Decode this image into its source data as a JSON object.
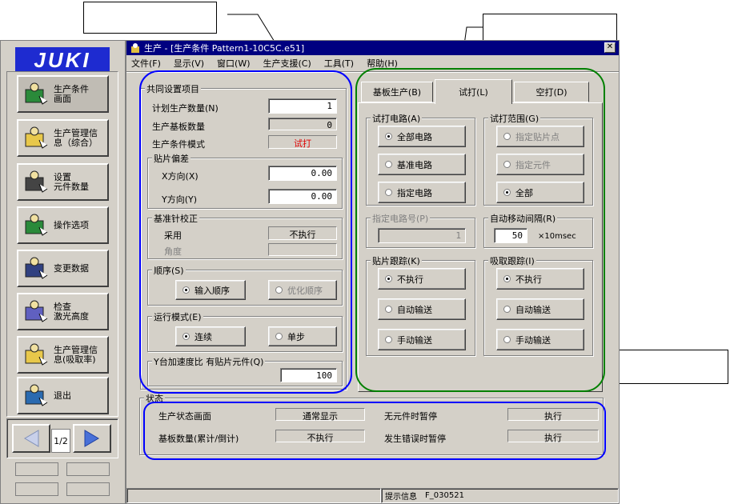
{
  "sidebar": {
    "logo": "JUKI",
    "items": [
      {
        "label": "生产条件\n画面",
        "icon": "production-condition-icon"
      },
      {
        "label": "生产管理信\n息（综合）",
        "icon": "production-info-icon"
      },
      {
        "label": "设置\n元件数量",
        "icon": "component-count-icon"
      },
      {
        "label": "操作选项",
        "icon": "operation-option-icon"
      },
      {
        "label": "变更数据",
        "icon": "edit-data-icon"
      },
      {
        "label": "检查\n激光高度",
        "icon": "laser-height-icon"
      },
      {
        "label": "生产管理信\n息(吸取率)",
        "icon": "pickup-rate-icon"
      },
      {
        "label": "退出",
        "icon": "exit-door-icon"
      }
    ],
    "page_indicator": "1/2"
  },
  "window": {
    "title": "生产 - [生产条件 Pattern1-10C5C.e51]",
    "menu": [
      "文件(F)",
      "显示(V)",
      "窗口(W)",
      "生产支援(C)",
      "工具(T)",
      "帮助(H)"
    ]
  },
  "common": {
    "group_title": "共同设置项目",
    "planned_qty_label": "计划生产数量(N)",
    "planned_qty": "1",
    "produced_qty_label": "生产基板数量",
    "produced_qty": "0",
    "mode_label": "生产条件模式",
    "mode_value": "试打",
    "offset_group": "贴片偏差",
    "x_label": "X方向(X)",
    "x_value": "0.00",
    "y_label": "Y方向(Y)",
    "y_value": "0.00",
    "ref_group": "基准针校正",
    "adopt_label": "采用",
    "adopt_value": "不执行",
    "angle_label": "角度",
    "angle_value": "",
    "order_group": "顺序(S)",
    "order_input": "输入顺序",
    "order_opt": "优化顺序",
    "run_group": "运行模式(E)",
    "run_cont": "连续",
    "run_step": "单步",
    "accel_label": "Y台加速度比 有贴片元件(Q)",
    "accel_value": "100"
  },
  "tabs": [
    "基板生产(B)",
    "试打(L)",
    "空打(D)"
  ],
  "trial": {
    "circuit_group": "试打电路(A)",
    "circuit_all": "全部电路",
    "circuit_base": "基准电路",
    "circuit_spec": "指定电路",
    "range_group": "试打范围(G)",
    "range_point": "指定贴片点",
    "range_comp": "指定元件",
    "range_all": "全部",
    "circuit_no_group": "指定电路号(P)",
    "circuit_no": "1",
    "interval_group": "自动移动间隔(R)",
    "interval_value": "50",
    "interval_unit": "×10msec",
    "mount_track_group": "贴片跟踪(K)",
    "mount_no": "不执行",
    "mount_auto": "自动输送",
    "mount_manual": "手动输送",
    "pick_track_group": "吸取跟踪(I)",
    "pick_no": "不执行",
    "pick_auto": "自动输送",
    "pick_manual": "手动输送"
  },
  "status": {
    "group_title": "状态",
    "screen_label": "生产状态画面",
    "screen_value": "通常显示",
    "count_label": "基板数量(累计/倒计)",
    "count_value": "不执行",
    "nocomp_label": "无元件时暂停",
    "nocomp_value": "执行",
    "error_label": "发生错误时暂停",
    "error_value": "执行"
  },
  "statusbar": {
    "text": "提示信息",
    "code": "F_030521"
  },
  "colors": {
    "blue_outline": "#0000ff",
    "green_outline": "#008000",
    "face": "#d4d0c8"
  }
}
